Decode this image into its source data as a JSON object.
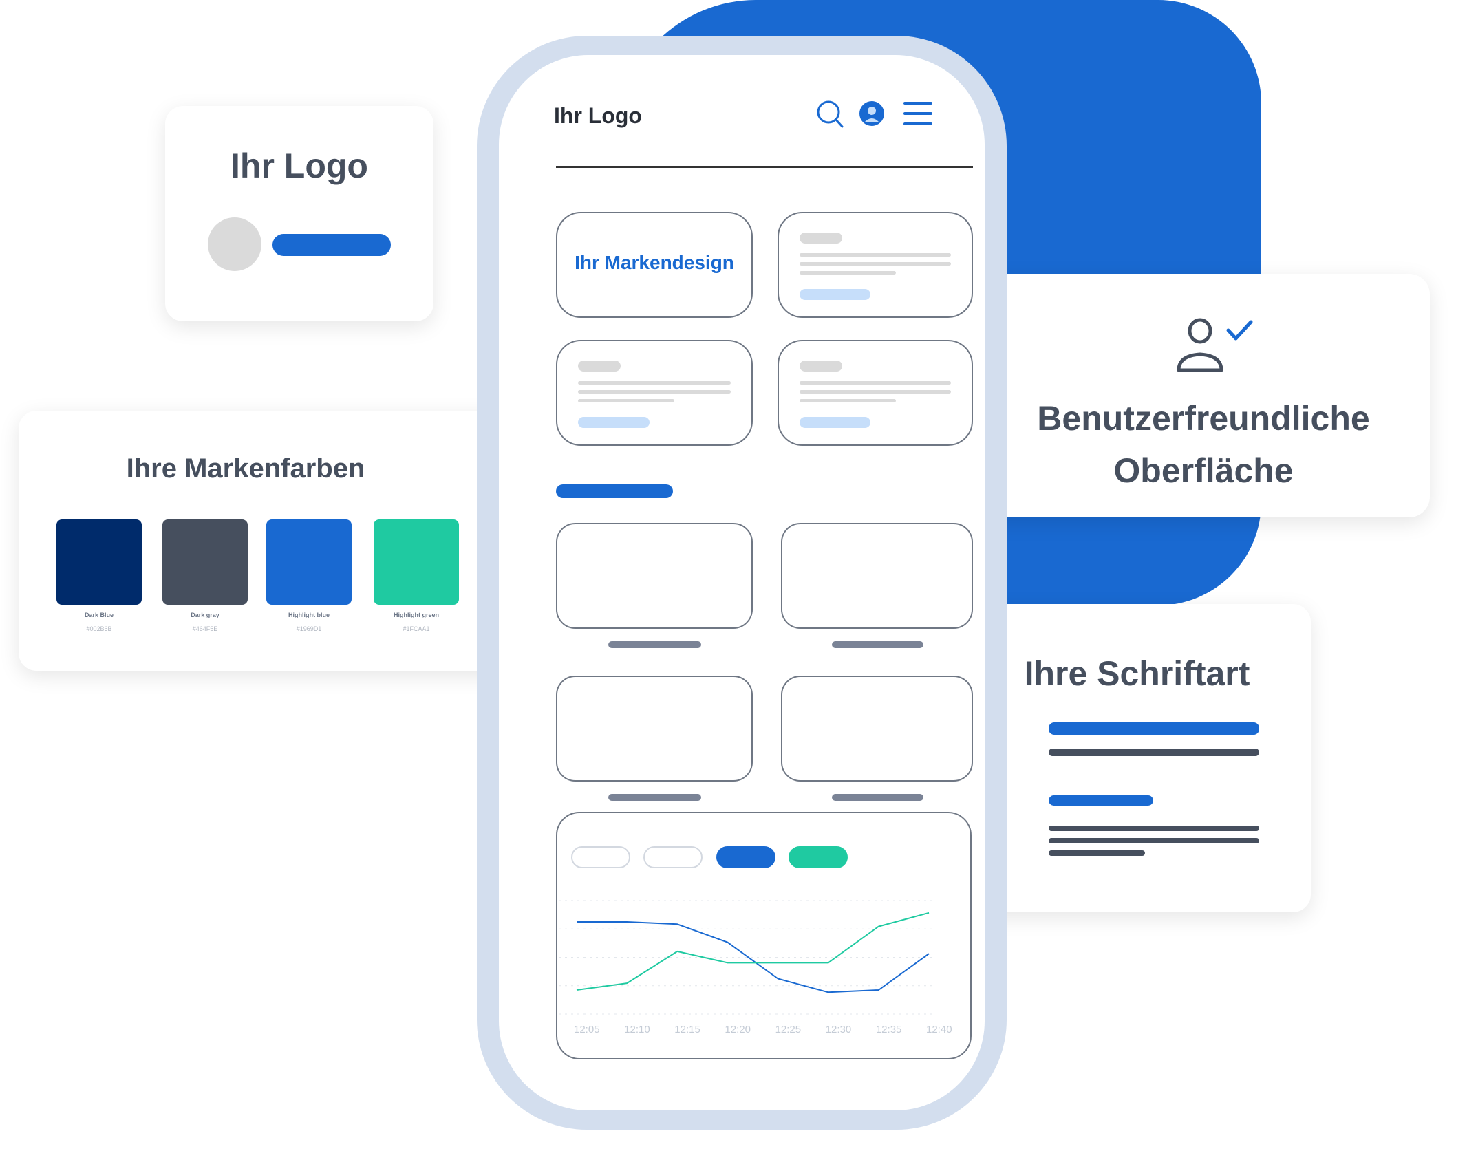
{
  "logo_card": {
    "title": "Ihr Logo"
  },
  "colors_card": {
    "title": "Ihre Markenfarben",
    "swatches": [
      {
        "name": "Dark Blue",
        "hex": "#002B6B",
        "color": "#002B6B"
      },
      {
        "name": "Dark gray",
        "hex": "#464F5E",
        "color": "#464F5E"
      },
      {
        "name": "Highlight blue",
        "hex": "#1969D1",
        "color": "#1969D1"
      },
      {
        "name": "Highlight green",
        "hex": "#1FCAA1",
        "color": "#1FCAA1"
      }
    ]
  },
  "ux_card": {
    "line1": "Benutzerfreundliche",
    "line2": "Oberfläche",
    "icon": "user-check-icon"
  },
  "font_card": {
    "title": "Ihre Schriftart"
  },
  "phone": {
    "logo": "Ihr Logo",
    "icons": [
      "search-icon",
      "user-avatar-icon",
      "hamburger-menu-icon"
    ],
    "brand_tile": "Ihr Markendesign"
  },
  "colors": {
    "accent": "#1969D1",
    "green": "#1FCAA1",
    "dark_gray": "#464F5E"
  },
  "chart_data": {
    "type": "line",
    "x": [
      "12:05",
      "12:10",
      "12:15",
      "12:20",
      "12:25",
      "12:30",
      "12:35",
      "12:40"
    ],
    "series": [
      {
        "name": "blue",
        "color": "#1969D1",
        "values": [
          80,
          80,
          78,
          62,
          30,
          18,
          20,
          52
        ]
      },
      {
        "name": "green",
        "color": "#1FCAA1",
        "values": [
          20,
          26,
          54,
          44,
          44,
          44,
          76,
          88
        ]
      }
    ],
    "ylim": [
      0,
      100
    ],
    "grid": true,
    "legend": "top-left"
  }
}
